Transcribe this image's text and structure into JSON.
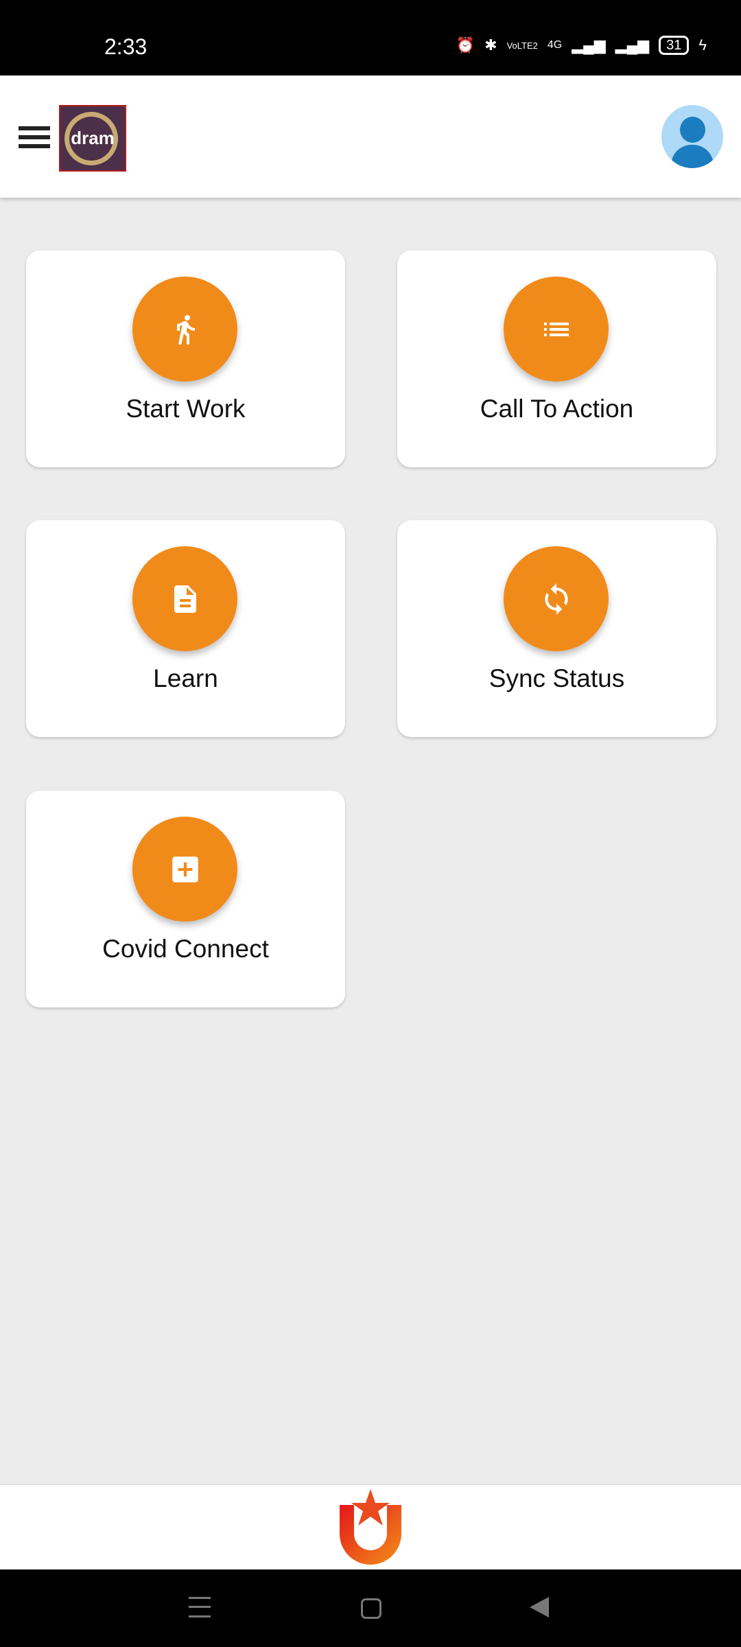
{
  "status_bar": {
    "time": "2:33",
    "network": "4G",
    "lte": "VoLTE2",
    "battery": "31"
  },
  "header": {
    "logo_text": "dram",
    "menu_icon": "hamburger-icon",
    "avatar_icon": "user-icon"
  },
  "tiles": [
    {
      "label": "Start Work",
      "icon": "running-person-icon"
    },
    {
      "label": "Call To Action",
      "icon": "list-icon"
    },
    {
      "label": "Learn",
      "icon": "document-icon"
    },
    {
      "label": "Sync Status",
      "icon": "sync-icon"
    },
    {
      "label": "Covid Connect",
      "icon": "medical-plus-icon"
    }
  ],
  "colors": {
    "accent": "#f08b1a",
    "background": "#ececec",
    "avatar_bg": "#aed9f7",
    "avatar_fg": "#1b7dbf"
  }
}
